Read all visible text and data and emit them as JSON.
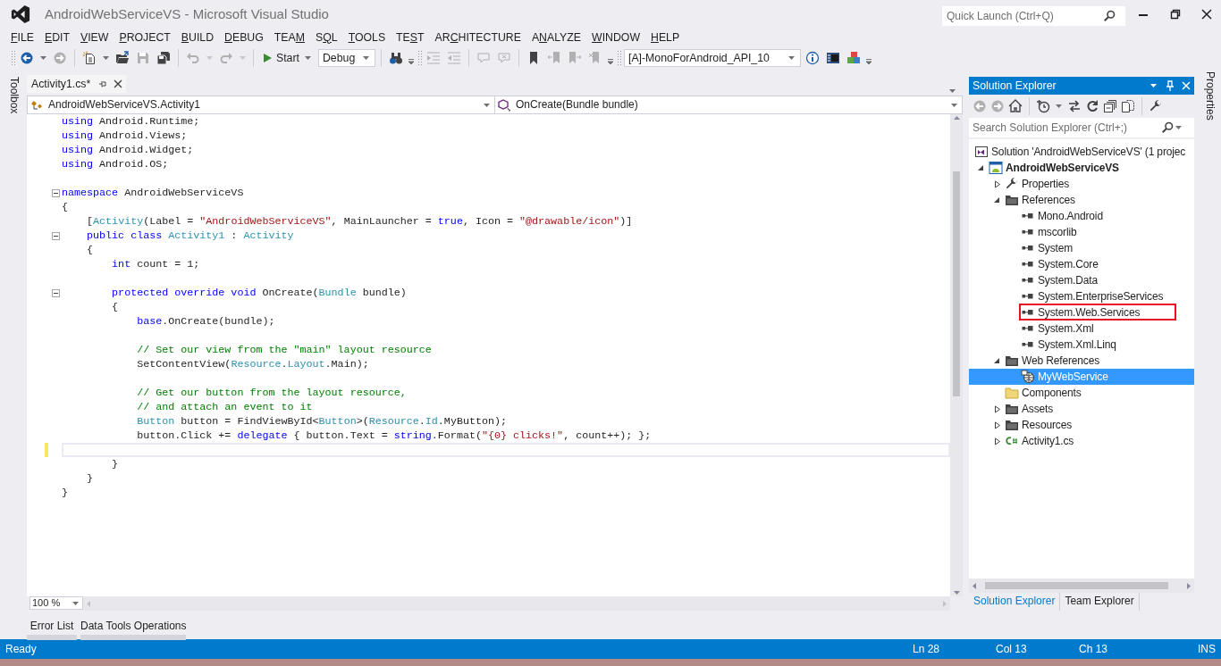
{
  "window": {
    "title": "AndroidWebServiceVS - Microsoft Visual Studio"
  },
  "quick_launch": {
    "placeholder": "Quick Launch (Ctrl+Q)"
  },
  "menu": [
    {
      "key": "F",
      "rest": "ILE"
    },
    {
      "key": "E",
      "rest": "DIT"
    },
    {
      "key": "V",
      "rest": "IEW"
    },
    {
      "key": "P",
      "rest": "ROJECT"
    },
    {
      "key": "B",
      "rest": "UILD"
    },
    {
      "key": "D",
      "rest": "EBUG"
    },
    {
      "lead": "TEA",
      "key": "M"
    },
    {
      "lead": "S",
      "key": "Q",
      "rest": "L"
    },
    {
      "key": "T",
      "rest": "OOLS"
    },
    {
      "lead": "TE",
      "key": "S",
      "rest": "T"
    },
    {
      "lead": "AR",
      "key": "C",
      "rest": "HITECTURE"
    },
    {
      "lead": "A",
      "key": "N",
      "rest": "ALYZE"
    },
    {
      "key": "W",
      "rest": "INDOW"
    },
    {
      "key": "H",
      "rest": "ELP"
    }
  ],
  "toolbar": {
    "start_label": "Start",
    "configuration": "Debug",
    "platform": "[A]-MonoForAndroid_API_10"
  },
  "toolbar_buttons": [
    {
      "disabled": false
    },
    {
      "disabled": true
    },
    {
      "disabled": false
    },
    {
      "disabled": false
    },
    {
      "disabled": true
    },
    {
      "disabled": false
    },
    {
      "disabled": true
    },
    {
      "disabled": true
    },
    {
      "disabled": false
    },
    {
      "disabled": true
    },
    {
      "disabled": true
    },
    {
      "disabled": true
    },
    {
      "disabled": true
    },
    {
      "disabled": false
    },
    {
      "disabled": true
    },
    {
      "disabled": true
    },
    {
      "disabled": true
    },
    {
      "disabled": false
    },
    {
      "disabled": false
    },
    {
      "disabled": false
    }
  ],
  "left_tool_tabs": [
    "Toolbox"
  ],
  "right_tool_tabs": [
    "Properties"
  ],
  "document_tabs": [
    {
      "label": "Activity1.cs*",
      "selected": true
    }
  ],
  "navigation_bar": {
    "class_dropdown": "AndroidWebServiceVS.Activity1",
    "member_dropdown": "OnCreate(Bundle bundle)"
  },
  "code_lines": [
    {
      "kind": "code",
      "tokens": [
        {
          "kind": "keyword",
          "text": "using"
        },
        {
          "kind": "plain",
          "text": " Android.Runtime;"
        }
      ]
    },
    {
      "kind": "code",
      "tokens": [
        {
          "kind": "keyword",
          "text": "using"
        },
        {
          "kind": "plain",
          "text": " Android.Views;"
        }
      ]
    },
    {
      "kind": "code",
      "tokens": [
        {
          "kind": "keyword",
          "text": "using"
        },
        {
          "kind": "plain",
          "text": " Android.Widget;"
        }
      ]
    },
    {
      "kind": "code",
      "tokens": [
        {
          "kind": "keyword",
          "text": "using"
        },
        {
          "kind": "plain",
          "text": " Android.OS;"
        }
      ]
    },
    {
      "kind": "blank"
    },
    {
      "kind": "code",
      "fold": true,
      "tokens": [
        {
          "kind": "keyword",
          "text": "namespace"
        },
        {
          "kind": "plain",
          "text": " AndroidWebServiceVS"
        }
      ]
    },
    {
      "kind": "code",
      "tokens": [
        {
          "kind": "plain",
          "text": "{"
        }
      ]
    },
    {
      "kind": "code",
      "tokens": [
        {
          "kind": "plain",
          "text": "    ["
        },
        {
          "kind": "type",
          "text": "Activity"
        },
        {
          "kind": "plain",
          "text": "(Label = "
        },
        {
          "kind": "string",
          "text": "\"AndroidWebServiceVS\""
        },
        {
          "kind": "plain",
          "text": ", MainLauncher = "
        },
        {
          "kind": "keyword",
          "text": "true"
        },
        {
          "kind": "plain",
          "text": ", Icon = "
        },
        {
          "kind": "string",
          "text": "\"@drawable/icon\""
        },
        {
          "kind": "plain",
          "text": ")]"
        }
      ]
    },
    {
      "kind": "code",
      "fold": true,
      "tokens": [
        {
          "kind": "keyword",
          "text": "    public class"
        },
        {
          "kind": "type",
          "text": " Activity1"
        },
        {
          "kind": "plain",
          "text": " : "
        },
        {
          "kind": "type",
          "text": "Activity"
        }
      ]
    },
    {
      "kind": "code",
      "tokens": [
        {
          "kind": "plain",
          "text": "    {"
        }
      ]
    },
    {
      "kind": "code",
      "tokens": [
        {
          "kind": "keyword",
          "text": "        int"
        },
        {
          "kind": "plain",
          "text": " count = 1;"
        }
      ]
    },
    {
      "kind": "blank"
    },
    {
      "kind": "code",
      "fold": true,
      "tokens": [
        {
          "kind": "keyword",
          "text": "        protected override void"
        },
        {
          "kind": "plain",
          "text": " OnCreate("
        },
        {
          "kind": "type",
          "text": "Bundle"
        },
        {
          "kind": "plain",
          "text": " bundle)"
        }
      ]
    },
    {
      "kind": "code",
      "tokens": [
        {
          "kind": "plain",
          "text": "        {"
        }
      ]
    },
    {
      "kind": "code",
      "tokens": [
        {
          "kind": "keyword",
          "text": "            base"
        },
        {
          "kind": "plain",
          "text": ".OnCreate(bundle);"
        }
      ]
    },
    {
      "kind": "blank"
    },
    {
      "kind": "code",
      "tokens": [
        {
          "kind": "comment",
          "text": "            // Set our view from the \"main\" layout resource"
        }
      ]
    },
    {
      "kind": "code",
      "tokens": [
        {
          "kind": "plain",
          "text": "            SetContentView("
        },
        {
          "kind": "type",
          "text": "Resource"
        },
        {
          "kind": "plain",
          "text": "."
        },
        {
          "kind": "type",
          "text": "Layout"
        },
        {
          "kind": "plain",
          "text": ".Main);"
        }
      ]
    },
    {
      "kind": "blank"
    },
    {
      "kind": "code",
      "tokens": [
        {
          "kind": "comment",
          "text": "            // Get our button from the layout resource,"
        }
      ]
    },
    {
      "kind": "code",
      "tokens": [
        {
          "kind": "comment",
          "text": "            // and attach an event to it"
        }
      ]
    },
    {
      "kind": "code",
      "tokens": [
        {
          "kind": "type",
          "text": "            Button"
        },
        {
          "kind": "plain",
          "text": " button = FindViewById<"
        },
        {
          "kind": "type",
          "text": "Button"
        },
        {
          "kind": "plain",
          "text": ">("
        },
        {
          "kind": "type",
          "text": "Resource"
        },
        {
          "kind": "plain",
          "text": "."
        },
        {
          "kind": "type",
          "text": "Id"
        },
        {
          "kind": "plain",
          "text": ".MyButton);"
        }
      ]
    },
    {
      "kind": "code",
      "tokens": [
        {
          "kind": "plain",
          "text": "            button.Click += "
        },
        {
          "kind": "keyword",
          "text": "delegate"
        },
        {
          "kind": "plain",
          "text": " { button.Text = "
        },
        {
          "kind": "keyword",
          "text": "string"
        },
        {
          "kind": "plain",
          "text": ".Format("
        },
        {
          "kind": "string",
          "text": "\"{0} clicks!\""
        },
        {
          "kind": "plain",
          "text": ", count++); };"
        }
      ]
    },
    {
      "kind": "blank",
      "changed": true,
      "current": true
    },
    {
      "kind": "code",
      "tokens": [
        {
          "kind": "plain",
          "text": "        }"
        }
      ]
    },
    {
      "kind": "code",
      "tokens": [
        {
          "kind": "plain",
          "text": "    }"
        }
      ]
    },
    {
      "kind": "code",
      "tokens": [
        {
          "kind": "plain",
          "text": "}"
        }
      ]
    }
  ],
  "zoom": "100 %",
  "bottom_tabs": [
    "Error List",
    "Data Tools Operations"
  ],
  "solution_explorer": {
    "title": "Solution Explorer",
    "toolbar_buttons": [
      {
        "disabled": true
      },
      {
        "disabled": true
      },
      {
        "disabled": false
      },
      {
        "disabled": false
      },
      {
        "disabled": false
      },
      {
        "disabled": false
      },
      {
        "disabled": false
      },
      {
        "disabled": false
      },
      {
        "disabled": false
      }
    ],
    "search": {
      "placeholder": "Search Solution Explorer (Ctrl+;)"
    },
    "tree": [
      {
        "kind": "solution",
        "label": "Solution 'AndroidWebServiceVS' (1 projec",
        "selected": false,
        "children": [
          {
            "kind": "project",
            "label": "AndroidWebServiceVS",
            "bold": true,
            "expanded": true,
            "selected": false,
            "children": [
              {
                "kind": "properties",
                "label": "Properties",
                "expanded": false,
                "selected": false
              },
              {
                "kind": "folder",
                "label": "References",
                "expanded": true,
                "selected": false,
                "children": [
                  {
                    "kind": "reference",
                    "label": "Mono.Android",
                    "selected": false,
                    "outlined": false
                  },
                  {
                    "kind": "reference",
                    "label": "mscorlib",
                    "selected": false,
                    "outlined": false
                  },
                  {
                    "kind": "reference",
                    "label": "System",
                    "selected": false,
                    "outlined": false
                  },
                  {
                    "kind": "reference",
                    "label": "System.Core",
                    "selected": false,
                    "outlined": false
                  },
                  {
                    "kind": "reference",
                    "label": "System.Data",
                    "selected": false,
                    "outlined": false
                  },
                  {
                    "kind": "reference",
                    "label": "System.EnterpriseServices",
                    "selected": false,
                    "outlined": false
                  },
                  {
                    "kind": "reference",
                    "label": "System.Web.Services",
                    "selected": false,
                    "outlined": true
                  },
                  {
                    "kind": "reference",
                    "label": "System.Xml",
                    "selected": false,
                    "outlined": false
                  },
                  {
                    "kind": "reference",
                    "label": "System.Xml.Linq",
                    "selected": false,
                    "outlined": false
                  }
                ]
              },
              {
                "kind": "folder",
                "label": "Web References",
                "expanded": true,
                "selected": false,
                "children": [
                  {
                    "kind": "web-reference",
                    "label": "MyWebService",
                    "selected": true
                  }
                ]
              },
              {
                "kind": "empty-folder",
                "label": "Components",
                "selected": false
              },
              {
                "kind": "folder",
                "label": "Assets",
                "expanded": false,
                "selected": false
              },
              {
                "kind": "folder",
                "label": "Resources",
                "expanded": false,
                "selected": false
              },
              {
                "kind": "csharp-file",
                "label": "Activity1.cs",
                "expanded": false,
                "selected": false
              }
            ]
          }
        ]
      }
    ],
    "tabs": [
      {
        "label": "Solution Explorer",
        "selected": true
      },
      {
        "label": "Team Explorer",
        "selected": false
      }
    ]
  },
  "status_bar": {
    "message": "Ready",
    "fields": [
      "Ln 28",
      "Col 13",
      "Ch 13",
      "INS"
    ]
  }
}
